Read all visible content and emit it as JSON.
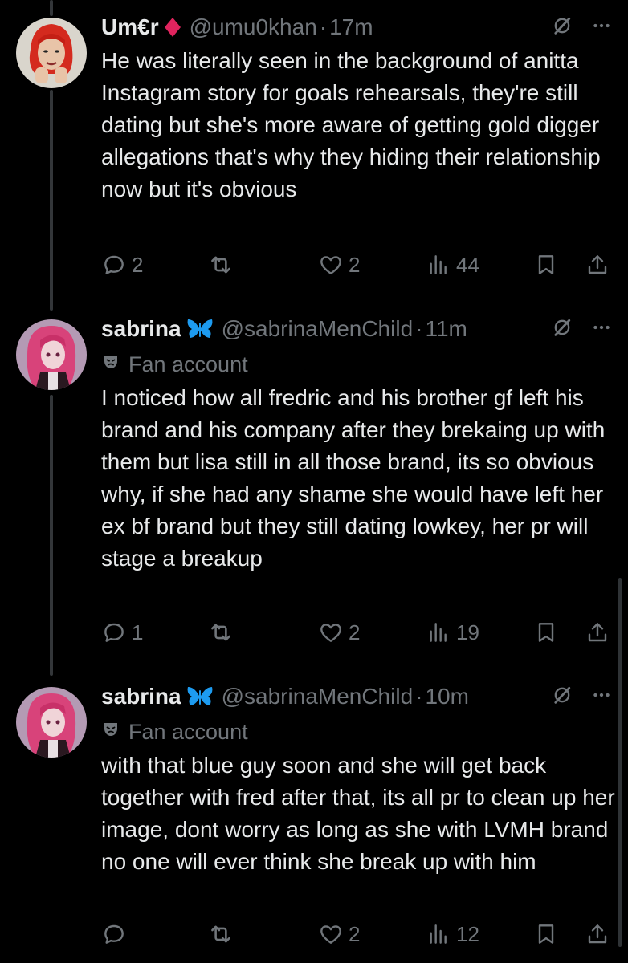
{
  "tweets": [
    {
      "name": "Um€r",
      "handle": "@umu0khan",
      "dot": "·",
      "time": "17m",
      "label": "",
      "text": "He was literally seen in the background of anitta Instagram story for goals rehearsals, they're still dating but she's more aware of getting gold digger allegations that's why they hiding their relationship now but it's obvious",
      "replies": "2",
      "retweets": "",
      "likes": "2",
      "views": "44"
    },
    {
      "name": "sabrina",
      "handle": "@sabrinaMenChild",
      "dot": "·",
      "time": "11m",
      "label": "Fan account",
      "text": "I noticed how all fredric and his brother gf left his brand and his company after they brekaing up with them but lisa still in all those brand, its so obvious why, if she had any shame she would have left her ex bf brand but they still dating lowkey, her pr will stage a breakup",
      "replies": "1",
      "retweets": "",
      "likes": "2",
      "views": "19"
    },
    {
      "name": "sabrina",
      "handle": "@sabrinaMenChild",
      "dot": "·",
      "time": "10m",
      "label": "Fan account",
      "text": "with that blue guy soon and she will get back together with fred after that, its all pr to clean up her image, dont worry as long as she with LVMH brand no one will ever think she break up with him",
      "replies": "",
      "retweets": "",
      "likes": "2",
      "views": "12"
    }
  ],
  "colors": {
    "background": "#000000",
    "text": "#e7e9ea",
    "muted": "#71767b",
    "badge_red": "#e0245e",
    "badge_blue": "#1d9bf0",
    "thread_line": "#333639"
  },
  "icons": [
    "reply-icon",
    "retweet-icon",
    "like-icon",
    "views-icon",
    "bookmark-icon",
    "share-icon",
    "grok-icon",
    "more-icon",
    "fan-mask-icon",
    "red-diamond-icon",
    "blue-butterfly-icon"
  ]
}
